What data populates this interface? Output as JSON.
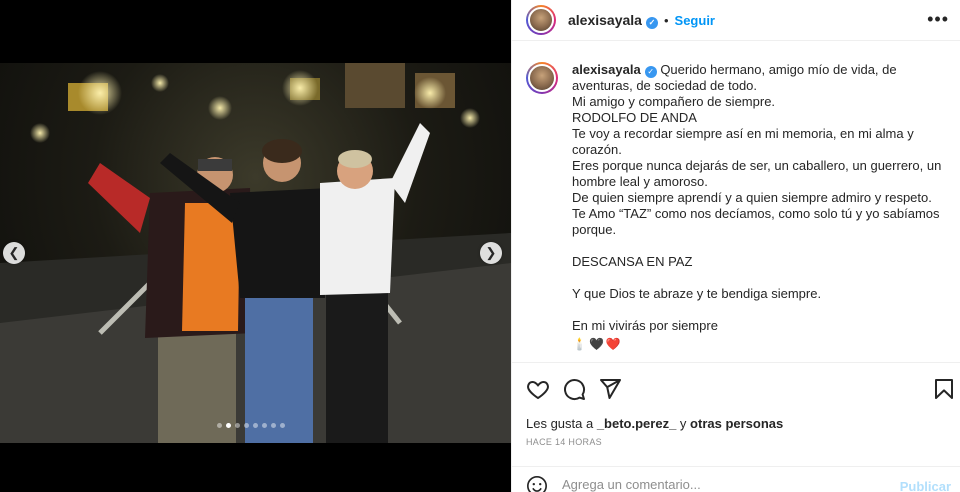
{
  "post": {
    "username": "alexisayala",
    "header": {
      "separator": "•",
      "follow_label": "Seguir",
      "more_icon": "more-options-icon"
    },
    "caption_lines": [
      "Querido hermano, amigo mío de vida, de",
      "aventuras, de sociedad de todo.",
      "Mi amigo y compañero de siempre.",
      "RODOLFO DE ANDA",
      "Te voy a recordar siempre así en mi memoria, en mi alma y",
      "corazón.",
      "Eres porque nunca dejarás de ser, un caballero, un guerrero, un",
      "hombre leal y amoroso.",
      "De quien siempre aprendí y a quien siempre admiro y respeto.",
      "Te Amo “TAZ” como nos decíamos, como solo tú y yo sabíamos",
      "porque.",
      "",
      "DESCANSA EN PAZ",
      "",
      "Y que Dios te abraze y te bendiga siempre.",
      "",
      "En mi vivirás por siempre"
    ],
    "caption_emojis": [
      "🕯️",
      "🖤",
      "❤️"
    ],
    "likes": {
      "prefix": "Les gusta a ",
      "user": "_beto.perez_",
      "middle": " y ",
      "others": "otras personas"
    },
    "timestamp": "HACE 14 HORAS",
    "comment": {
      "placeholder": "Agrega un comentario...",
      "publish_label": "Publicar"
    }
  },
  "carousel": {
    "dot_count": 8,
    "active_index": 1
  },
  "colors": {
    "link_blue": "#0095f6",
    "verified_blue": "#3897f0",
    "publish_disabled": "#b2dffc",
    "secondary_text": "#8e8e8e"
  }
}
